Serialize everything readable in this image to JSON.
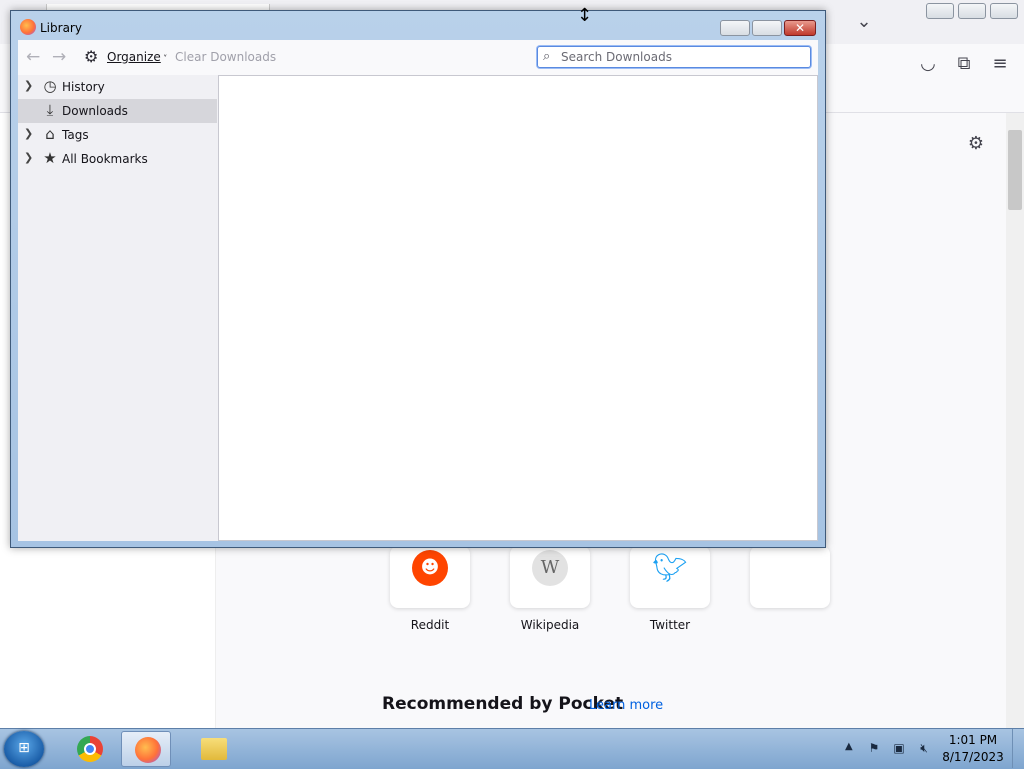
{
  "library": {
    "title": "Library",
    "organize_label": "Organize",
    "clear_downloads_label": "Clear Downloads",
    "search_placeholder": "Search Downloads",
    "sidebar": [
      {
        "label": "History",
        "icon": "clock-icon",
        "expandable": true
      },
      {
        "label": "Downloads",
        "icon": "download-icon",
        "expandable": false,
        "selected": true
      },
      {
        "label": "Tags",
        "icon": "tag-icon",
        "expandable": true
      },
      {
        "label": "All Bookmarks",
        "icon": "star-icon",
        "expandable": true
      }
    ]
  },
  "background": {
    "top_sites": [
      {
        "label": "Reddit",
        "icon": "reddit-icon",
        "color": "#ff4500"
      },
      {
        "label": "Wikipedia",
        "icon": "wikipedia-icon",
        "color": "#888888"
      },
      {
        "label": "Twitter",
        "icon": "twitter-icon",
        "color": "#1da1f2"
      }
    ],
    "pocket_heading": "Recommended by Pocket",
    "pocket_link": "Learn more"
  },
  "taskbar": {
    "time": "1:01 PM",
    "date": "8/17/2023"
  },
  "colors": {
    "accent": "#0061e0",
    "selection": "#d6d6db"
  }
}
